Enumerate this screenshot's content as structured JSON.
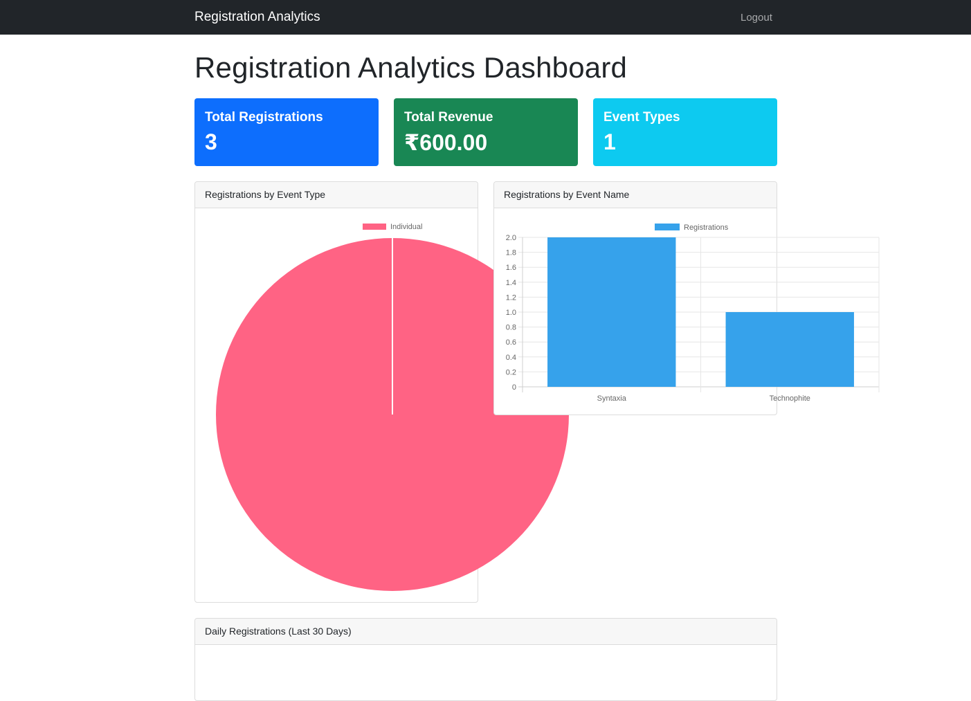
{
  "navbar": {
    "brand": "Registration Analytics",
    "logout": "Logout"
  },
  "page_title": "Registration Analytics Dashboard",
  "stats": [
    {
      "label": "Total Registrations",
      "value": "3",
      "color": "#0d6efd"
    },
    {
      "label": "Total Revenue",
      "value": "₹600.00",
      "color": "#198754"
    },
    {
      "label": "Event Types",
      "value": "1",
      "color": "#0dcaf0"
    }
  ],
  "cards": {
    "event_type": "Registrations by Event Type",
    "event_name": "Registrations by Event Name",
    "daily": "Daily Registrations (Last 30 Days)"
  },
  "chart_data": [
    {
      "type": "pie",
      "categories": [
        "Individual"
      ],
      "values": [
        1
      ],
      "legend": [
        "Individual"
      ],
      "colors": [
        "#ff6384"
      ]
    },
    {
      "type": "bar",
      "categories": [
        "Syntaxia",
        "Technophite"
      ],
      "series": [
        {
          "name": "Registrations",
          "values": [
            2,
            1
          ],
          "color": "#36a2eb"
        }
      ],
      "yticks": [
        "0",
        "0.2",
        "0.4",
        "0.6",
        "0.8",
        "1.0",
        "1.2",
        "1.4",
        "1.6",
        "1.8",
        "2.0"
      ],
      "ylim": [
        0,
        2
      ],
      "legend_position": "top",
      "grid": true
    }
  ]
}
